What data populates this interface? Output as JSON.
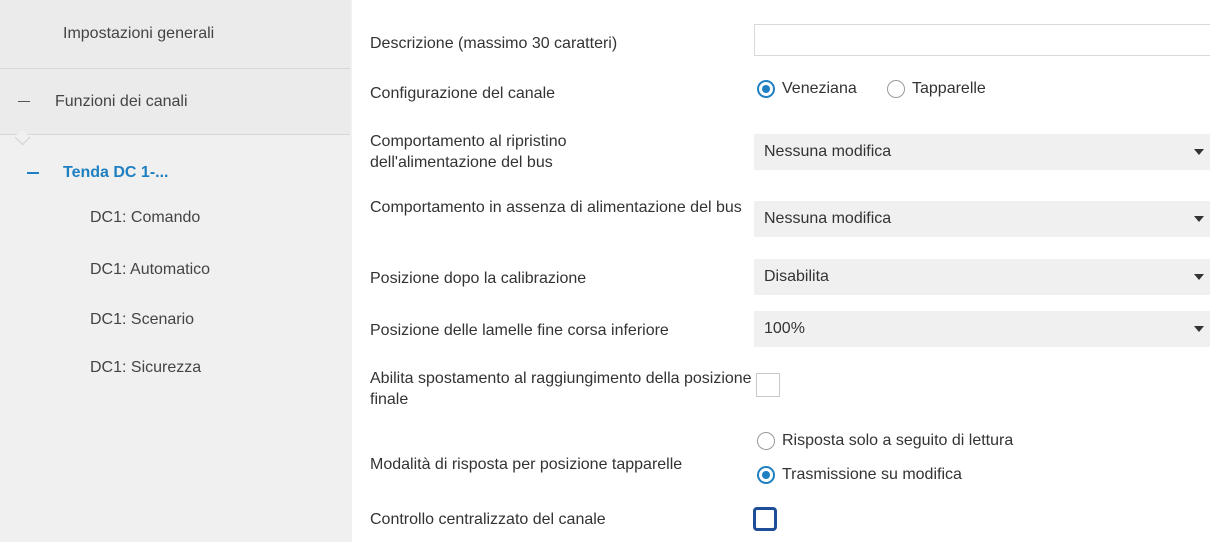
{
  "sidebar": {
    "items": [
      {
        "label": "Impostazioni generali"
      },
      {
        "label": "Funzioni dei canali"
      },
      {
        "label": "Tenda DC 1-..."
      },
      {
        "label": "DC1: Comando"
      },
      {
        "label": "DC1: Automatico"
      },
      {
        "label": "DC1: Scenario"
      },
      {
        "label": "DC1: Sicurezza"
      }
    ]
  },
  "params": {
    "description": {
      "label": "Descrizione (massimo 30 caratteri)",
      "value": ""
    },
    "channel_config": {
      "label": "Configurazione del canale",
      "options": [
        "Veneziana",
        "Tapparelle"
      ],
      "selected": "Veneziana"
    },
    "bus_restore": {
      "label": "Comportamento al ripristino dell'alimentazione del bus",
      "value": "Nessuna modifica"
    },
    "bus_absence": {
      "label": "Comportamento in assenza di alimentazione del bus",
      "value": "Nessuna modifica"
    },
    "calibration_pos": {
      "label": "Posizione dopo la calibrazione",
      "value": "Disabilita"
    },
    "slat_pos": {
      "label": "Posizione delle lamelle fine corsa inferiore",
      "value": "100%"
    },
    "move_final": {
      "label": "Abilita spostamento al raggiungimento della posizione finale",
      "checked": false
    },
    "response_mode": {
      "label": "Modalità di risposta per posizione tapparelle",
      "options": [
        "Risposta solo a seguito di lettura",
        "Trasmissione su modifica"
      ],
      "selected": "Trasmissione su modifica"
    },
    "central_control": {
      "label": "Controllo centralizzato del canale",
      "checked": false
    }
  },
  "colors": {
    "accent": "#1e7fc1",
    "sidebar_bg": "#f0f0f0",
    "dropdown_bg": "#f0f0f0"
  }
}
